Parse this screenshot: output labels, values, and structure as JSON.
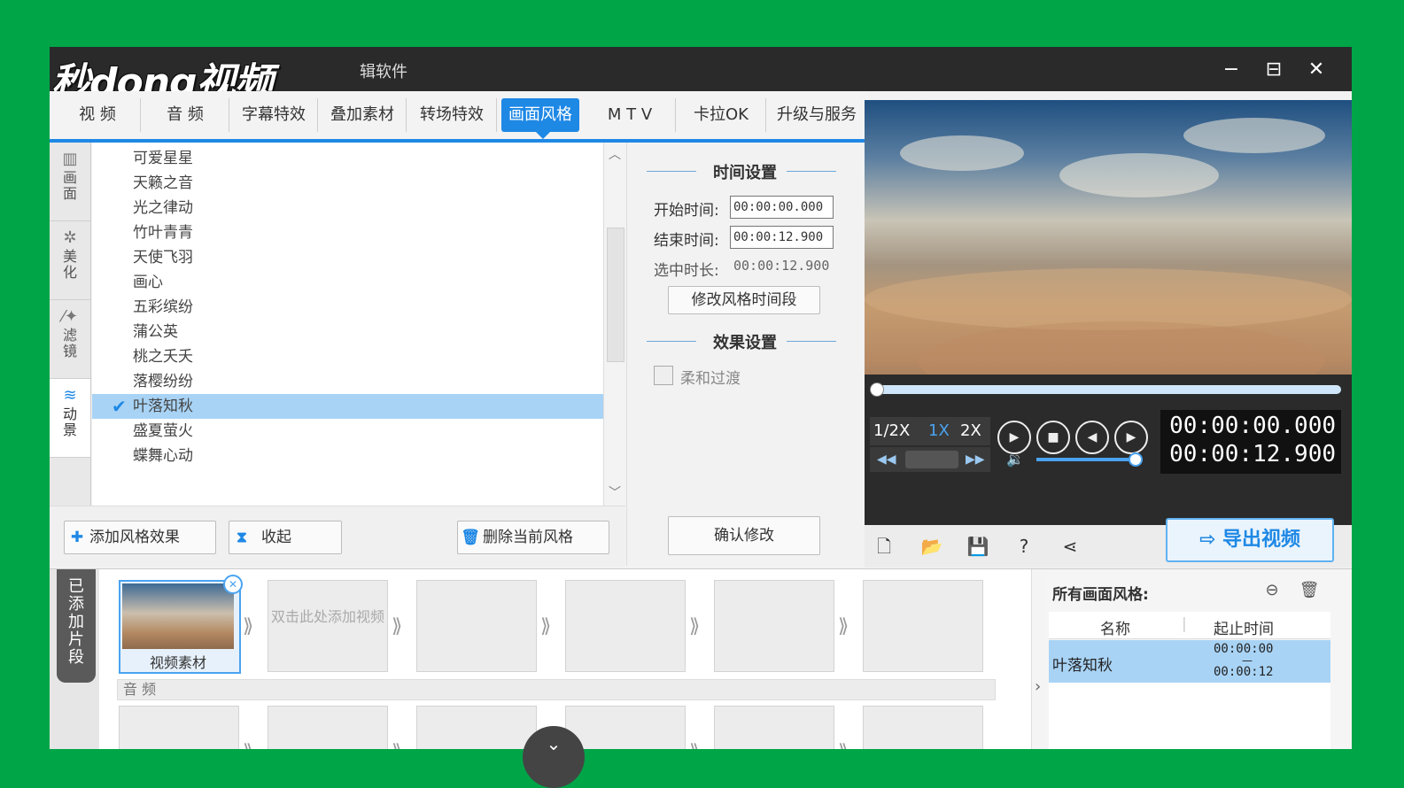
{
  "window": {
    "watermark": "秒dong视频",
    "app_title_partial": "辑软件",
    "controls": {
      "minimize": "−",
      "maximize": "⊟",
      "close": "✕"
    }
  },
  "tabs": [
    {
      "label": "视  频",
      "active": false
    },
    {
      "label": "音  频",
      "active": false
    },
    {
      "label": "字幕特效",
      "active": false
    },
    {
      "label": "叠加素材",
      "active": false
    },
    {
      "label": "转场特效",
      "active": false
    },
    {
      "label": "画面风格",
      "active": true
    },
    {
      "label": "M T V",
      "active": false
    },
    {
      "label": "卡拉OK",
      "active": false
    },
    {
      "label": "升级与服务",
      "active": false
    }
  ],
  "side_tabs": [
    {
      "label": "画面",
      "icon": "film-icon",
      "active": false
    },
    {
      "label": "美化",
      "icon": "magic-icon",
      "active": false
    },
    {
      "label": "滤镜",
      "icon": "wand-icon",
      "active": false
    },
    {
      "label": "动景",
      "icon": "wave-icon",
      "active": true
    }
  ],
  "style_list": [
    "可爱星星",
    "天籁之音",
    "光之律动",
    "竹叶青青",
    "天使飞羽",
    "画心",
    "五彩缤纷",
    "蒲公英",
    "桃之夭夭",
    "落樱纷纷",
    "叶落知秋",
    "盛夏萤火",
    "蝶舞心动"
  ],
  "selected_style": "叶落知秋",
  "list_buttons": {
    "add": "添加风格效果",
    "collapse": "收起",
    "delete": "删除当前风格"
  },
  "time_settings": {
    "title": "时间设置",
    "start_label": "开始时间:",
    "start_value": "00:00:00.000",
    "end_label": "结束时间:",
    "end_value": "00:00:12.900",
    "duration_label": "选中时长:",
    "duration_value": "00:00:12.900",
    "modify_button": "修改风格时间段"
  },
  "effect_settings": {
    "title": "效果设置",
    "smooth_label": "柔和过渡"
  },
  "confirm_button": "确认修改",
  "player": {
    "speeds": [
      "1/2X",
      "1X",
      "2X"
    ],
    "current_speed": "1X",
    "current_time": "00:00:00.000",
    "total_time": "00:00:12.900",
    "export_button": "导出视频",
    "progress": 0,
    "volume": 0.95
  },
  "timeline": {
    "added_label": "已添加片段",
    "first_clip_label": "视频素材",
    "add_hint": "双击此处添加视频",
    "audio_label": "音 频"
  },
  "right_panel": {
    "title": "所有画面风格:",
    "col_name": "名称",
    "col_time": "起止时间",
    "row_name": "叶落知秋",
    "row_start": "00:00:00",
    "row_end": "00:00:12"
  }
}
